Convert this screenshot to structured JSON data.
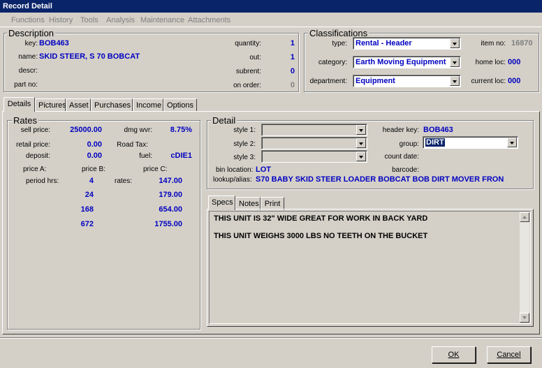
{
  "window": {
    "title": "Record Detail"
  },
  "menu": [
    "Functions",
    "History",
    "Tools",
    "Analysis",
    "Maintenance",
    "Attachments"
  ],
  "description": {
    "title": "Description",
    "key_label": "key:",
    "key": "BOB463",
    "name_label": "name:",
    "name": "SKID STEER, S 70 BOBCAT",
    "descr_label": "descr:",
    "partno_label": "part no:",
    "quantity_label": "quantity:",
    "quantity": "1",
    "out_label": "out:",
    "out": "1",
    "subrent_label": "subrent:",
    "subrent": "0",
    "onorder_label": "on order:",
    "onorder": "0"
  },
  "classifications": {
    "title": "Classifications",
    "type_label": "type:",
    "type": "Rental - Header",
    "category_label": "category:",
    "category": "Earth Moving Equipment",
    "department_label": "department:",
    "department": "Equipment",
    "itemno_label": "item no:",
    "itemno": "16870",
    "homeloc_label": "home loc:",
    "homeloc": "000",
    "currentloc_label": "current loc:",
    "currentloc": "000"
  },
  "tabs": [
    "Details",
    "Pictures",
    "Asset",
    "Purchases",
    "Income",
    "Options"
  ],
  "rates": {
    "title": "Rates",
    "sell_label": "sell price:",
    "sell": "25000.00",
    "dmg_label": "dmg wvr:",
    "dmg": "8.75%",
    "retail_label": "retail price:",
    "retail": "0.00",
    "roadtax_label": "Road Tax:",
    "deposit_label": "deposit:",
    "deposit": "0.00",
    "fuel_label": "fuel:",
    "fuel": "cDIE1",
    "priceA_label": "price A:",
    "priceB_label": "price B:",
    "priceC_label": "price C:",
    "period_label": "period hrs:",
    "rates_label": "rates:",
    "periods": [
      {
        "hrs": "4",
        "rate": "147.00"
      },
      {
        "hrs": "24",
        "rate": "179.00"
      },
      {
        "hrs": "168",
        "rate": "654.00"
      },
      {
        "hrs": "672",
        "rate": "1755.00"
      }
    ]
  },
  "detail": {
    "title": "Detail",
    "style1_label": "style 1:",
    "style2_label": "style 2:",
    "style3_label": "style 3:",
    "headerkey_label": "header key:",
    "headerkey": "BOB463",
    "group_label": "group:",
    "group": "DIRT",
    "countdate_label": "count date:",
    "bin_label": "bin location:",
    "bin": "LOT",
    "barcode_label": "barcode:",
    "lookup_label": "lookup/alias:",
    "lookup": "S70 BABY SKID STEER LOADER BOBCAT BOB DIRT MOVER FRON"
  },
  "subtabs": [
    "Specs",
    "Notes",
    "Print"
  ],
  "specs": {
    "line1": "THIS UNIT IS 32\" WIDE GREAT FOR WORK IN BACK YARD",
    "line2": "THIS UNIT WEIGHS 3000 LBS NO TEETH ON THE BUCKET"
  },
  "buttons": {
    "ok": "OK",
    "cancel": "Cancel"
  }
}
